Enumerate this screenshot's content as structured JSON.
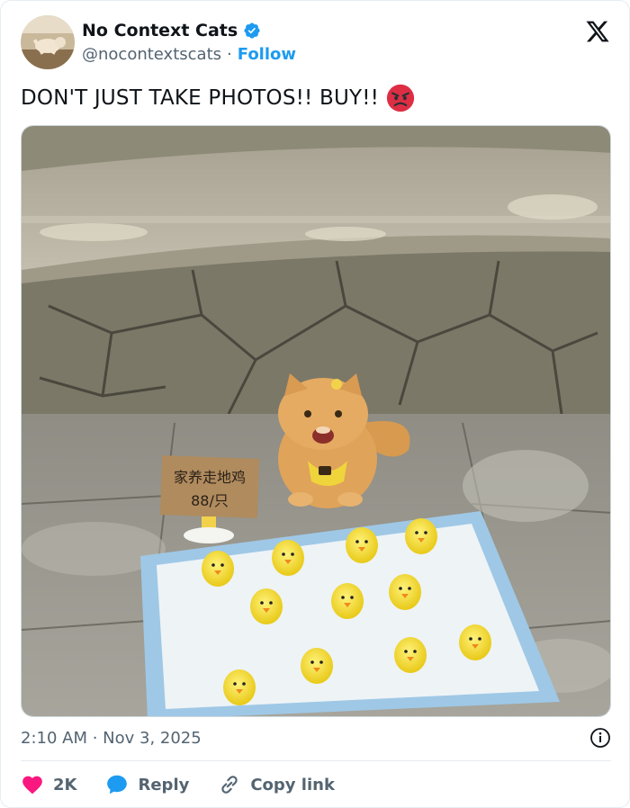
{
  "account": {
    "display_name": "No Context Cats",
    "handle": "@nocontextscats",
    "separator": "·",
    "follow_label": "Follow"
  },
  "tweet": {
    "text": "DON'T JUST TAKE PHOTOS!! BUY!!",
    "emoji": "angry-face"
  },
  "media": {
    "sign_line1": "家养走地鸡",
    "sign_line2": "88/只"
  },
  "meta": {
    "timestamp": "2:10 AM · Nov 3, 2025"
  },
  "actions": {
    "like_count": "2K",
    "reply_label": "Reply",
    "copy_label": "Copy link"
  },
  "colors": {
    "accent": "#1d9bf0",
    "like": "#f91880",
    "secondary_text": "#536471"
  }
}
